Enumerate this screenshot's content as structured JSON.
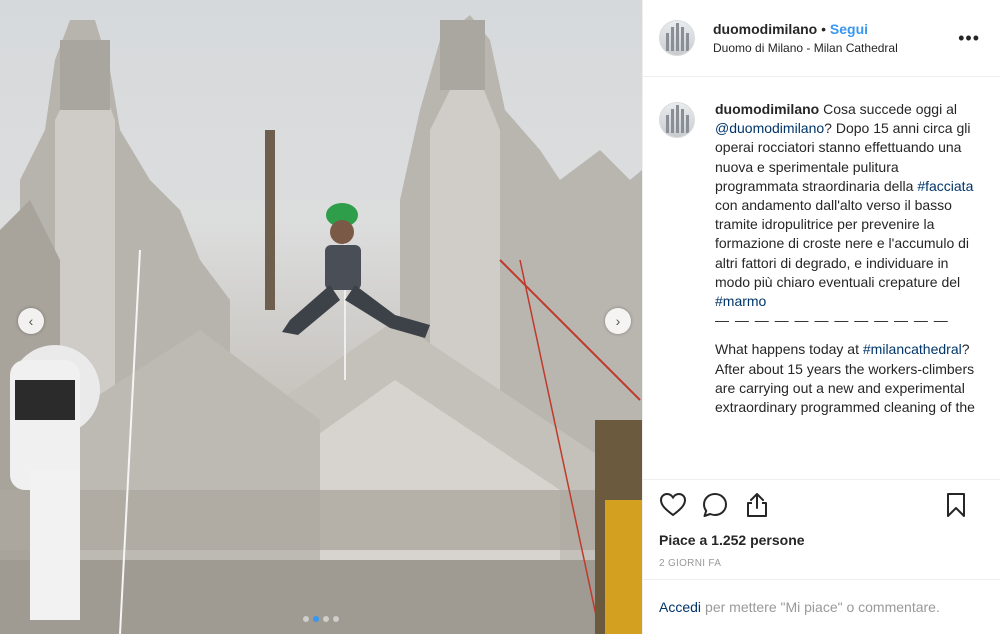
{
  "header": {
    "username": "duomodimilano",
    "separator": "•",
    "follow_label": "Segui",
    "location": "Duomo di Milano - Milan Cathedral",
    "more_label": "•••"
  },
  "photo": {
    "prev_label": "‹",
    "next_label": "›"
  },
  "caption": {
    "username": "duomodimilano",
    "text_1": "Cosa succede oggi al",
    "mention": "@duomodimilano",
    "text_2": "? Dopo 15 anni circa gli operai rocciatori stanno effettuando una nuova e sperimentale pulitura programmata straordinaria della",
    "hashtag_1": "#facciata",
    "text_3": "con andamento dall'alto verso il basso tramite idropulitrice per prevenire la formazione di croste nere e l'accumulo di altri fattori di degrado, e individuare in modo più chiaro eventuali crepature del",
    "hashtag_2": "#marmo",
    "dashes": "— — — — — — — — — — — —",
    "en_1": "What happens today at",
    "hashtag_3": "#milancathedral",
    "en_2": "? After about 15 years the workers-climbers are carrying out a new and experimental extraordinary programmed cleaning of the"
  },
  "actions": {
    "like_icon": "heart-icon",
    "comment_icon": "comment-icon",
    "share_icon": "share-icon",
    "save_icon": "bookmark-icon",
    "likes_text": "Piace a 1.252 persone",
    "time_ago": "2 GIORNI FA"
  },
  "login": {
    "accedi": "Accedi",
    "rest": "per mettere \"Mi piace\" o commentare."
  },
  "colors": {
    "accent": "#3897f0",
    "link": "#003569",
    "muted": "#999999"
  }
}
